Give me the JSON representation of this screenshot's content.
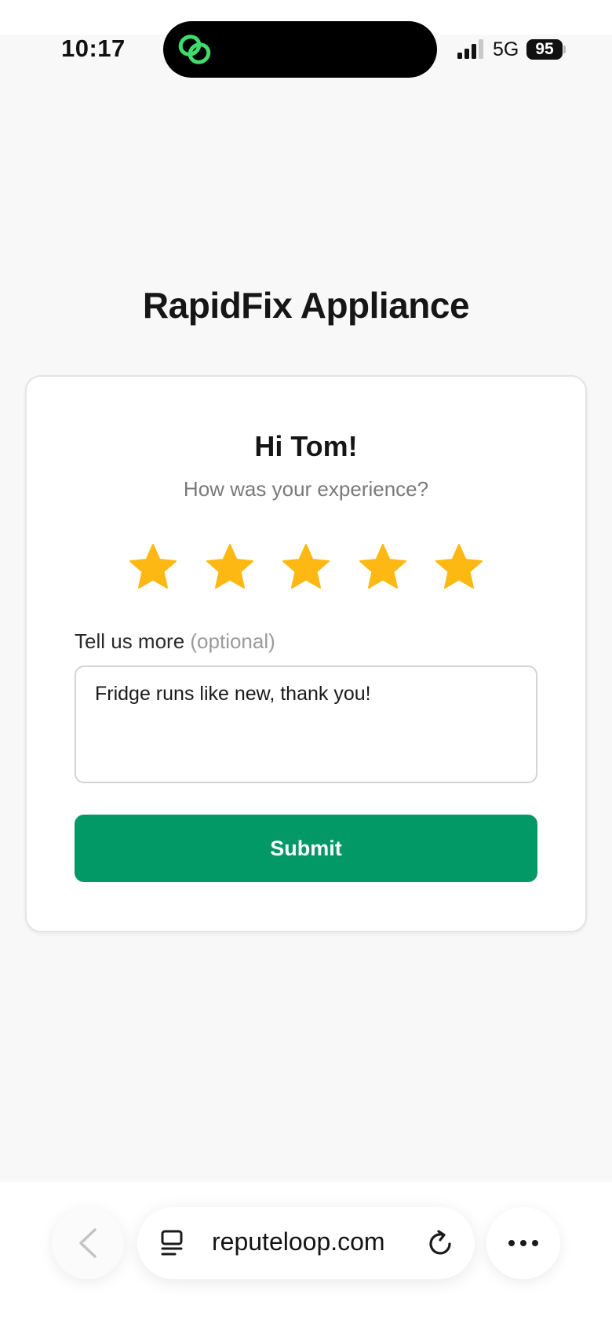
{
  "status_bar": {
    "time": "10:17",
    "network": "5G",
    "battery": "95",
    "island_icon": "link-rings-icon",
    "island_icon_color": "#3ddc6b"
  },
  "page": {
    "brand_title": "RapidFix Appliance",
    "greeting": "Hi Tom!",
    "prompt": "How was your experience?",
    "rating": {
      "value": 5,
      "max": 5,
      "star_color": "#FDB813"
    },
    "more_label": "Tell us more",
    "more_optional": "(optional)",
    "feedback_value": "Fridge runs like new, thank you!",
    "submit_label": "Submit",
    "accent_color": "#039966"
  },
  "browser": {
    "url": "reputeloop.com",
    "icons": [
      "back-chevron-icon",
      "tabs-icon",
      "reload-icon",
      "more-dots-icon"
    ]
  }
}
